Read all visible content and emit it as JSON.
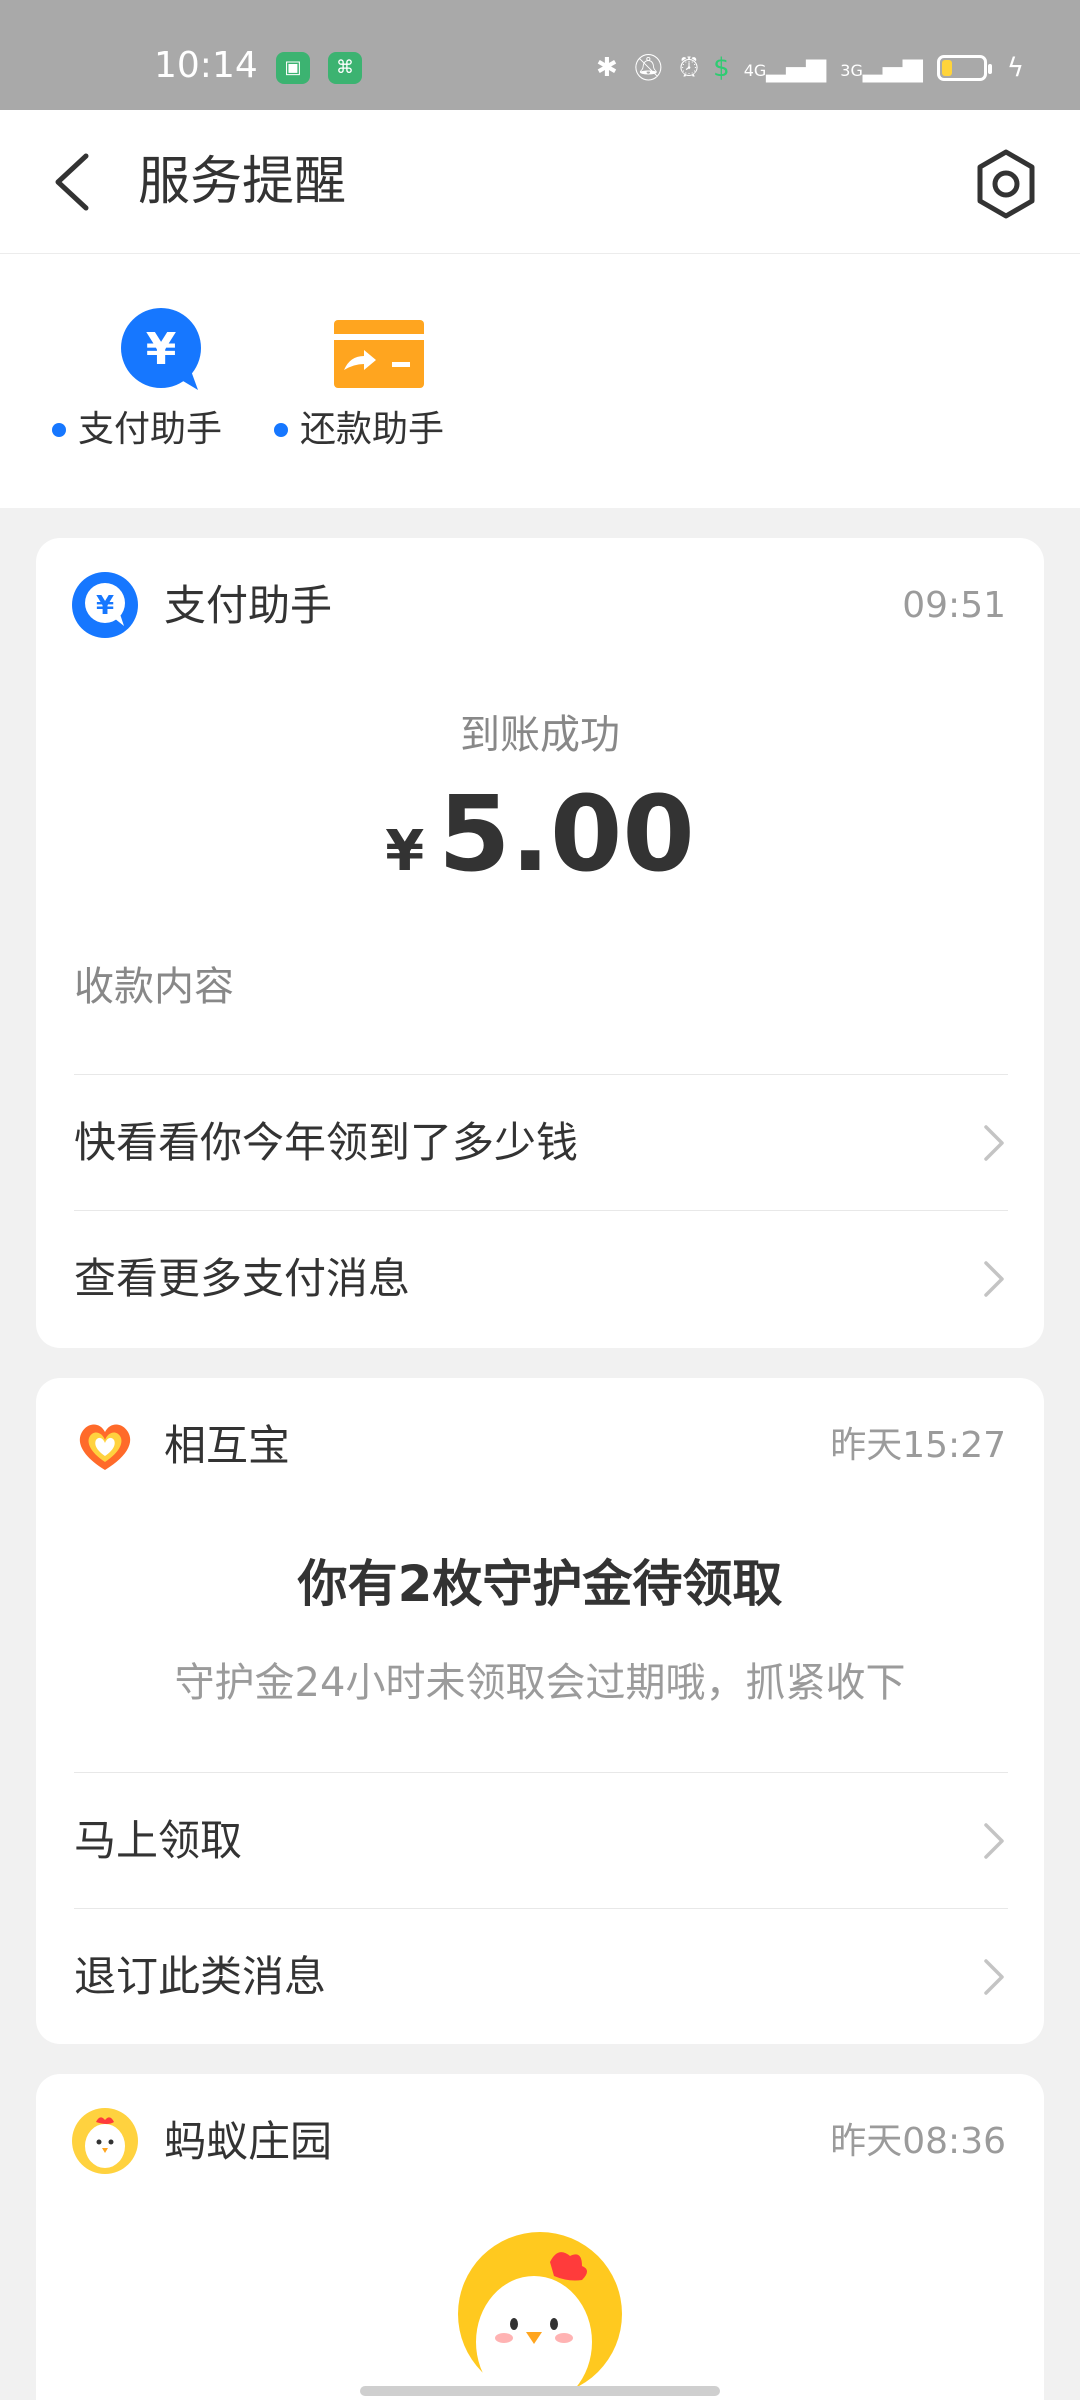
{
  "status_bar": {
    "time": "10:14",
    "icons": [
      "bluetooth-icon",
      "mute-icon",
      "alarm-icon",
      "shield-icon",
      "signal-4g-icon",
      "signal-3g-icon",
      "battery-icon",
      "charging-icon"
    ],
    "network_4g": "4G",
    "network_3g": "3G",
    "battery_level": 0.25
  },
  "header": {
    "title": "服务提醒"
  },
  "services": [
    {
      "label": "支付助手",
      "icon": "yuan-chat-icon",
      "color": "#1677ff"
    },
    {
      "label": "还款助手",
      "icon": "card-transfer-icon",
      "color": "#ffa51f"
    }
  ],
  "cards": {
    "payment": {
      "source": "支付助手",
      "time": "09:51",
      "subtitle": "到账成功",
      "currency": "¥",
      "amount": "5.00",
      "content_label": "收款内容",
      "actions": [
        "快看看你今年领到了多少钱",
        "查看更多支付消息"
      ]
    },
    "mutual": {
      "source": "相互宝",
      "time": "昨天15:27",
      "title": "你有2枚守护金待领取",
      "desc": "守护金24小时未领取会过期哦，抓紧收下",
      "actions": [
        "马上领取",
        "退订此类消息"
      ]
    },
    "farm": {
      "source": "蚂蚁庄园",
      "time": "昨天08:36"
    }
  },
  "colors": {
    "accent": "#1677ff",
    "orange": "#ffa51f",
    "text": "#333333",
    "muted": "#9b9b9b",
    "background": "#f1f1f1"
  }
}
